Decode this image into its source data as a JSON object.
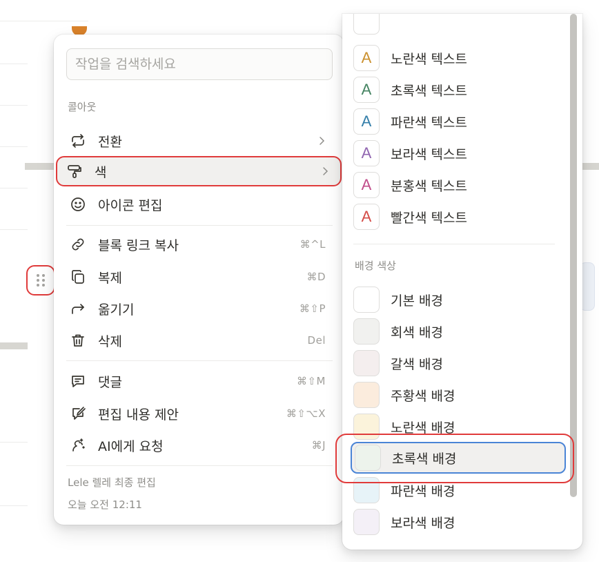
{
  "menu": {
    "search_placeholder": "작업을 검색하세요",
    "section_label": "콜아웃",
    "items": [
      {
        "label": "전환",
        "shortcut": "",
        "icon": "turn-into-icon",
        "has_submenu": true
      },
      {
        "label": "색",
        "shortcut": "",
        "icon": "paint-roller-icon",
        "has_submenu": true
      },
      {
        "label": "아이콘 편집",
        "shortcut": "",
        "icon": "smile-icon",
        "has_submenu": false
      },
      {
        "label": "블록 링크 복사",
        "shortcut": "⌘^L",
        "icon": "link-icon"
      },
      {
        "label": "복제",
        "shortcut": "⌘D",
        "icon": "duplicate-icon"
      },
      {
        "label": "옮기기",
        "shortcut": "⌘⇧P",
        "icon": "move-arrow-icon"
      },
      {
        "label": "삭제",
        "shortcut": "Del",
        "icon": "trash-icon"
      },
      {
        "label": "댓글",
        "shortcut": "⌘⇧M",
        "icon": "comment-icon"
      },
      {
        "label": "편집 내용 제안",
        "shortcut": "⌘⇧⌥X",
        "icon": "suggest-edit-icon"
      },
      {
        "label": "AI에게 요청",
        "shortcut": "⌘J",
        "icon": "ai-icon"
      }
    ],
    "footer": {
      "edited_by": "Lele 렐레 최종 편집",
      "edited_time": "오늘 오전 12:11"
    }
  },
  "color_submenu": {
    "text_colors": [
      {
        "label": "노란색 텍스트",
        "glyph": "A",
        "color": "#cb912f"
      },
      {
        "label": "초록색 텍스트",
        "glyph": "A",
        "color": "#448361"
      },
      {
        "label": "파란색 텍스트",
        "glyph": "A",
        "color": "#337ea9"
      },
      {
        "label": "보라색 텍스트",
        "glyph": "A",
        "color": "#9065b0"
      },
      {
        "label": "분홍색 텍스트",
        "glyph": "A",
        "color": "#c14c8a"
      },
      {
        "label": "빨간색 텍스트",
        "glyph": "A",
        "color": "#d44c47"
      }
    ],
    "background_heading": "배경 색상",
    "background_colors": [
      {
        "label": "기본 배경",
        "color": "#ffffff"
      },
      {
        "label": "회색 배경",
        "color": "#f1f1ef"
      },
      {
        "label": "갈색 배경",
        "color": "#f4eeee"
      },
      {
        "label": "주황색 배경",
        "color": "#fbecdd"
      },
      {
        "label": "노란색 배경",
        "color": "#fbf3db"
      },
      {
        "label": "초록색 배경",
        "color": "#edf3ec"
      },
      {
        "label": "파란색 배경",
        "color": "#e7f3f8"
      },
      {
        "label": "보라색 배경",
        "color": "#f4f0f7"
      }
    ],
    "selected": "초록색 배경"
  },
  "colors": {
    "highlight_ring": "#e03a3a",
    "focus_ring": "#4a84d6"
  }
}
